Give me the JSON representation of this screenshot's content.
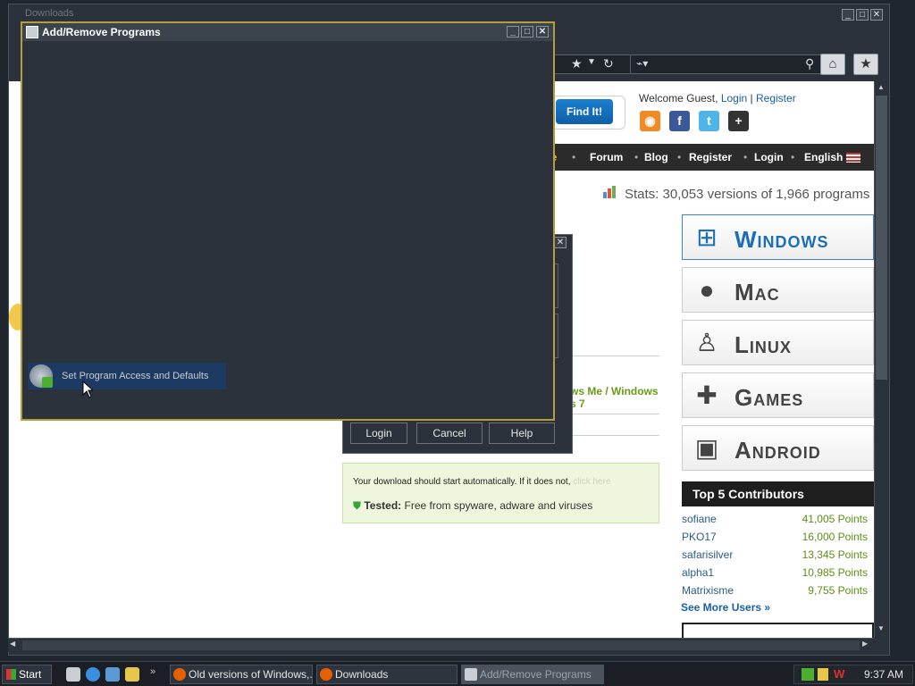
{
  "browser": {
    "title": "Downloads",
    "nav": [
      "Forum",
      "Blog",
      "Register",
      "Login",
      "English"
    ],
    "nav_partial": "re",
    "home_icon": "home-icon",
    "bookmarks_icon": "bookmarks-icon"
  },
  "webpage": {
    "find_button": "Find It!",
    "welcome_text": "Welcome Guest,",
    "login_link": "Login",
    "register_link": "Register",
    "stats": "Stats: 30,053 versions of 1,966 programs",
    "os_buttons": [
      "Windows",
      "Mac",
      "Linux",
      "Games",
      "Android"
    ],
    "contributors_title": "Top 5 Contributors",
    "contributors": [
      {
        "name": "sofiane",
        "points": "41,005 Points"
      },
      {
        "name": "PKO17",
        "points": "16,000 Points"
      },
      {
        "name": "safarisilver",
        "points": "13,345 Points"
      },
      {
        "name": "alpha1",
        "points": "10,985 Points"
      },
      {
        "name": "Matrixisme",
        "points": "9,755 Points"
      }
    ],
    "see_more": "See More Users »",
    "link_line1": "ws Me / Windows",
    "link_line2": "s 7",
    "download_notice": "Your download should start automatically. If it does not,",
    "download_link": "click here",
    "tested_label": "Tested:",
    "tested_text": "Free from spyware, adware and viruses"
  },
  "login_dialog": {
    "buttons": [
      "Login",
      "Cancel",
      "Help"
    ]
  },
  "arp": {
    "title": "Add/Remove Programs",
    "item_label": "Set Program Access and Defaults"
  },
  "taskbar": {
    "start": "Start",
    "tasks": [
      {
        "label": "Old versions of Windows,...",
        "active": false
      },
      {
        "label": "Downloads",
        "active": false
      },
      {
        "label": "Add/Remove Programs",
        "active": true
      }
    ],
    "clock": "9:37 AM"
  }
}
